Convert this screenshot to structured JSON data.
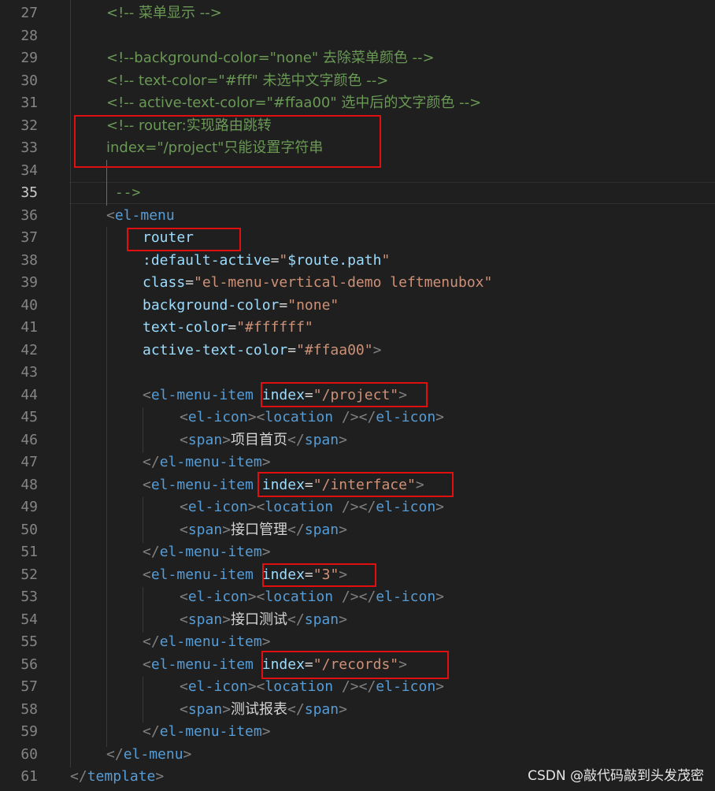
{
  "editor": {
    "active_line_number": "35",
    "line_numbers": [
      "27",
      "28",
      "29",
      "30",
      "31",
      "32",
      "33",
      "34",
      "35",
      "36",
      "37",
      "38",
      "39",
      "40",
      "41",
      "42",
      "43",
      "44",
      "45",
      "46",
      "47",
      "48",
      "49",
      "50",
      "51",
      "52",
      "53",
      "54",
      "55",
      "56",
      "57",
      "58",
      "59",
      "60",
      "61"
    ],
    "lines": [
      [
        {
          "t": "<!-- 菜单显示 -->",
          "c": "com"
        }
      ],
      [],
      [
        {
          "t": "<!--background-color=\"none\" 去除菜单颜色 -->",
          "c": "com"
        }
      ],
      [
        {
          "t": "<!-- text-color=\"#fff\" 未选中文字颜色 -->",
          "c": "com"
        }
      ],
      [
        {
          "t": "<!-- active-text-color=\"#ffaa00\" 选中后的文字颜色 -->",
          "c": "com"
        }
      ],
      [
        {
          "t": "<!-- router:实现路由跳转",
          "c": "com"
        }
      ],
      [
        {
          "t": "index=\"/project\"只能设置字符串",
          "c": "com"
        }
      ],
      [],
      [
        {
          "t": " -->",
          "c": "com"
        }
      ],
      [
        {
          "t": "<",
          "c": "punc"
        },
        {
          "t": "el-menu",
          "c": "tag"
        }
      ],
      [
        {
          "t": "router",
          "c": "attr"
        }
      ],
      [
        {
          "t": ":default-active",
          "c": "attr"
        },
        {
          "t": "=",
          "c": "eq"
        },
        {
          "t": "\"",
          "c": "str"
        },
        {
          "t": "$route.path",
          "c": "attr"
        },
        {
          "t": "\"",
          "c": "str"
        }
      ],
      [
        {
          "t": "class",
          "c": "attr"
        },
        {
          "t": "=",
          "c": "eq"
        },
        {
          "t": "\"el-menu-vertical-demo leftmenubox\"",
          "c": "str"
        }
      ],
      [
        {
          "t": "background-color",
          "c": "attr"
        },
        {
          "t": "=",
          "c": "eq"
        },
        {
          "t": "\"none\"",
          "c": "str"
        }
      ],
      [
        {
          "t": "text-color",
          "c": "attr"
        },
        {
          "t": "=",
          "c": "eq"
        },
        {
          "t": "\"#ffffff\"",
          "c": "str"
        }
      ],
      [
        {
          "t": "active-text-color",
          "c": "attr"
        },
        {
          "t": "=",
          "c": "eq"
        },
        {
          "t": "\"#ffaa00\"",
          "c": "str"
        },
        {
          "t": ">",
          "c": "punc"
        }
      ],
      [],
      [
        {
          "t": "<",
          "c": "punc"
        },
        {
          "t": "el-menu-item",
          "c": "tag"
        },
        {
          "t": " ",
          "c": "txt"
        },
        {
          "t": "index",
          "c": "attr"
        },
        {
          "t": "=",
          "c": "eq"
        },
        {
          "t": "\"/project\"",
          "c": "str"
        },
        {
          "t": ">",
          "c": "punc"
        }
      ],
      [
        {
          "t": "<",
          "c": "punc"
        },
        {
          "t": "el-icon",
          "c": "tag"
        },
        {
          "t": "><",
          "c": "punc"
        },
        {
          "t": "location",
          "c": "tag"
        },
        {
          "t": " />",
          "c": "punc"
        },
        {
          "t": "</",
          "c": "punc"
        },
        {
          "t": "el-icon",
          "c": "tag"
        },
        {
          "t": ">",
          "c": "punc"
        }
      ],
      [
        {
          "t": "<",
          "c": "punc"
        },
        {
          "t": "span",
          "c": "tag"
        },
        {
          "t": ">",
          "c": "punc"
        },
        {
          "t": "项目首页",
          "c": "txt"
        },
        {
          "t": "</",
          "c": "punc"
        },
        {
          "t": "span",
          "c": "tag"
        },
        {
          "t": ">",
          "c": "punc"
        }
      ],
      [
        {
          "t": "</",
          "c": "punc"
        },
        {
          "t": "el-menu-item",
          "c": "tag"
        },
        {
          "t": ">",
          "c": "punc"
        }
      ],
      [
        {
          "t": "<",
          "c": "punc"
        },
        {
          "t": "el-menu-item",
          "c": "tag"
        },
        {
          "t": " ",
          "c": "txt"
        },
        {
          "t": "index",
          "c": "attr"
        },
        {
          "t": "=",
          "c": "eq"
        },
        {
          "t": "\"/interface\"",
          "c": "str"
        },
        {
          "t": ">",
          "c": "punc"
        }
      ],
      [
        {
          "t": "<",
          "c": "punc"
        },
        {
          "t": "el-icon",
          "c": "tag"
        },
        {
          "t": "><",
          "c": "punc"
        },
        {
          "t": "location",
          "c": "tag"
        },
        {
          "t": " />",
          "c": "punc"
        },
        {
          "t": "</",
          "c": "punc"
        },
        {
          "t": "el-icon",
          "c": "tag"
        },
        {
          "t": ">",
          "c": "punc"
        }
      ],
      [
        {
          "t": "<",
          "c": "punc"
        },
        {
          "t": "span",
          "c": "tag"
        },
        {
          "t": ">",
          "c": "punc"
        },
        {
          "t": "接口管理",
          "c": "txt"
        },
        {
          "t": "</",
          "c": "punc"
        },
        {
          "t": "span",
          "c": "tag"
        },
        {
          "t": ">",
          "c": "punc"
        }
      ],
      [
        {
          "t": "</",
          "c": "punc"
        },
        {
          "t": "el-menu-item",
          "c": "tag"
        },
        {
          "t": ">",
          "c": "punc"
        }
      ],
      [
        {
          "t": "<",
          "c": "punc"
        },
        {
          "t": "el-menu-item",
          "c": "tag"
        },
        {
          "t": " ",
          "c": "txt"
        },
        {
          "t": "index",
          "c": "attr"
        },
        {
          "t": "=",
          "c": "eq"
        },
        {
          "t": "\"3\"",
          "c": "str"
        },
        {
          "t": ">",
          "c": "punc"
        }
      ],
      [
        {
          "t": "<",
          "c": "punc"
        },
        {
          "t": "el-icon",
          "c": "tag"
        },
        {
          "t": "><",
          "c": "punc"
        },
        {
          "t": "location",
          "c": "tag"
        },
        {
          "t": " />",
          "c": "punc"
        },
        {
          "t": "</",
          "c": "punc"
        },
        {
          "t": "el-icon",
          "c": "tag"
        },
        {
          "t": ">",
          "c": "punc"
        }
      ],
      [
        {
          "t": "<",
          "c": "punc"
        },
        {
          "t": "span",
          "c": "tag"
        },
        {
          "t": ">",
          "c": "punc"
        },
        {
          "t": "接口测试",
          "c": "txt"
        },
        {
          "t": "</",
          "c": "punc"
        },
        {
          "t": "span",
          "c": "tag"
        },
        {
          "t": ">",
          "c": "punc"
        }
      ],
      [
        {
          "t": "</",
          "c": "punc"
        },
        {
          "t": "el-menu-item",
          "c": "tag"
        },
        {
          "t": ">",
          "c": "punc"
        }
      ],
      [
        {
          "t": "<",
          "c": "punc"
        },
        {
          "t": "el-menu-item",
          "c": "tag"
        },
        {
          "t": " ",
          "c": "txt"
        },
        {
          "t": "index",
          "c": "attr"
        },
        {
          "t": "=",
          "c": "eq"
        },
        {
          "t": "\"/records\"",
          "c": "str"
        },
        {
          "t": ">",
          "c": "punc"
        }
      ],
      [
        {
          "t": "<",
          "c": "punc"
        },
        {
          "t": "el-icon",
          "c": "tag"
        },
        {
          "t": "><",
          "c": "punc"
        },
        {
          "t": "location",
          "c": "tag"
        },
        {
          "t": " />",
          "c": "punc"
        },
        {
          "t": "</",
          "c": "punc"
        },
        {
          "t": "el-icon",
          "c": "tag"
        },
        {
          "t": ">",
          "c": "punc"
        }
      ],
      [
        {
          "t": "<",
          "c": "punc"
        },
        {
          "t": "span",
          "c": "tag"
        },
        {
          "t": ">",
          "c": "punc"
        },
        {
          "t": "测试报表",
          "c": "txt"
        },
        {
          "t": "</",
          "c": "punc"
        },
        {
          "t": "span",
          "c": "tag"
        },
        {
          "t": ">",
          "c": "punc"
        }
      ],
      [
        {
          "t": "</",
          "c": "punc"
        },
        {
          "t": "el-menu-item",
          "c": "tag"
        },
        {
          "t": ">",
          "c": "punc"
        }
      ],
      [
        {
          "t": "</",
          "c": "punc"
        },
        {
          "t": "el-menu",
          "c": "tag"
        },
        {
          "t": ">",
          "c": "punc"
        }
      ],
      [
        {
          "t": "</",
          "c": "punc"
        },
        {
          "t": "template",
          "c": "tag"
        },
        {
          "t": ">",
          "c": "punc"
        }
      ]
    ]
  },
  "colors": {
    "background": "#1f1f1f",
    "comment": "#6a9955",
    "tag": "#569cd6",
    "attribute": "#9cdcfe",
    "string": "#ce9178",
    "punctuation": "#808080",
    "highlight_box": "#e10f0f"
  },
  "watermark": "CSDN @敲代码敲到头发茂密"
}
